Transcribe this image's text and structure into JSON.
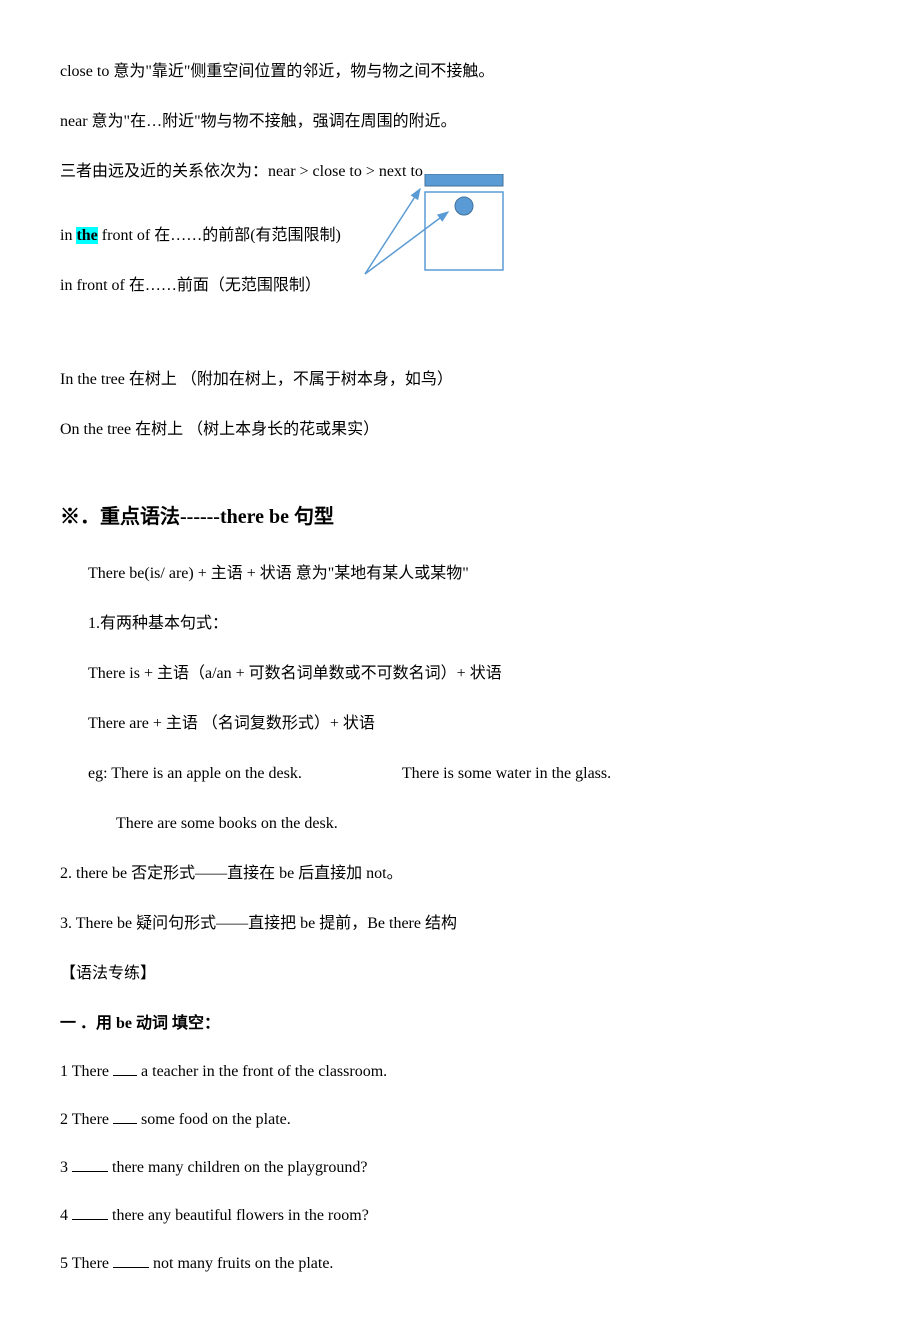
{
  "top_notes": {
    "line1": "close to  意为\"靠近\"侧重空间位置的邻近，物与物之间不接触。",
    "line2": "near  意为\"在…附近\"物与物不接触，强调在周围的附近。",
    "line3": "三者由远及近的关系依次为：near > close to > next to"
  },
  "front_of": {
    "prefix1": "in ",
    "the": "the",
    "rest1": " front of  在……的前部(有范围限制)",
    "line2": "in front of  在……前面（无范围限制）"
  },
  "tree": {
    "line1": "In the tree  在树上  （附加在树上，不属于树本身，如鸟）",
    "line2": "On the tree  在树上  （树上本身长的花或果实）"
  },
  "grammar": {
    "heading": "※．重点语法------there be  句型",
    "line1": "There be(is/ are) +  主语  +  状语  意为\"某地有某人或某物\"",
    "line2": "1.有两种基本句式：",
    "line3": "There is +  主语（a/an +  可数名词单数或不可数名词）+  状语",
    "line4": "There are +  主语  （名词复数形式）+  状语",
    "eg_prefix": "eg: There is an apple on the desk.",
    "eg_right": "There is some water in the glass.",
    "eg_line2": "There are some books on the desk.",
    "line6": "2.   there be  否定形式——直接在 be  后直接加 not。",
    "line7": "3.   There be  疑问句形式——直接把 be  提前，Be there  结构",
    "practice_label": "【语法专练】"
  },
  "exercise": {
    "heading": "一  ．用 be 动词  填空：",
    "q1_a": "1 There ",
    "q1_b": "   a  teacher  in  the  front  of  the  classroom.",
    "q2_a": " 2 There ",
    "q2_b": "   some  food  on  the  plate.",
    "q3_a": "3  ",
    "q3_b": "  there  many  children  on  the  playground?",
    "q4_a": " 4  ",
    "q4_b": "    there  any  beautiful  flowers  in    the  room?",
    "q5_a": " 5 There  ",
    "q5_b": "    not  many  fruits  on  the  plate."
  }
}
